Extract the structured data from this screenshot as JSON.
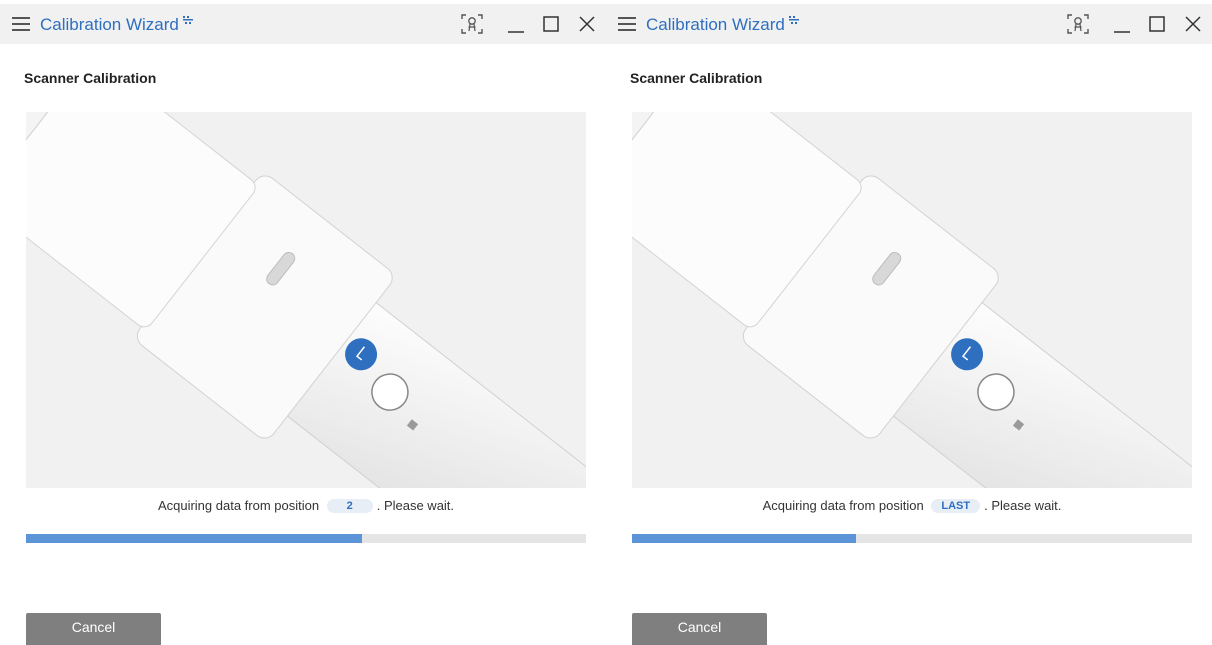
{
  "windows": [
    {
      "title": "Calibration Wizard",
      "heading": "Scanner Calibration",
      "status_prefix": "Acquiring data from position",
      "position": "2",
      "status_suffix": ". Please wait.",
      "progress": 0.6,
      "cancel_label": "Cancel"
    },
    {
      "title": "Calibration Wizard",
      "heading": "Scanner Calibration",
      "status_prefix": "Acquiring data from position",
      "position": "LAST",
      "status_suffix": ". Please wait.",
      "progress": 0.4,
      "cancel_label": "Cancel"
    }
  ],
  "icons": {
    "menu": "hamburger-menu-icon",
    "title_badge": "pin-icon",
    "scanner": "scanner-view-icon",
    "minimize": "minimize-icon",
    "maximize": "maximize-icon",
    "close": "close-icon"
  },
  "colors": {
    "accent": "#2f6fbf",
    "progress_fill": "#5b95d8",
    "progress_track": "#e5e5e5",
    "cancel_button": "#7f7f7f",
    "titlebar": "#f1f1f1",
    "scanner_button": "#2f6fbf"
  }
}
